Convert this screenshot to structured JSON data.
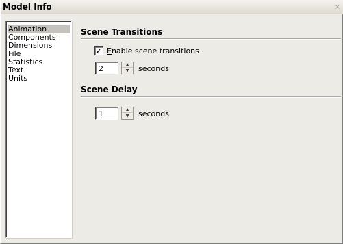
{
  "window": {
    "title": "Model Info",
    "close_glyph": "×"
  },
  "sidebar": {
    "items": [
      {
        "label": "Animation",
        "selected": true
      },
      {
        "label": "Components"
      },
      {
        "label": "Dimensions"
      },
      {
        "label": "File"
      },
      {
        "label": "Statistics"
      },
      {
        "label": "Text"
      },
      {
        "label": "Units"
      }
    ]
  },
  "scene_transitions": {
    "title": "Scene Transitions",
    "checkbox_label_mnemonic": "E",
    "checkbox_label_rest": "nable scene transitions",
    "checked": true,
    "checkmark": "✓",
    "value": "2",
    "unit": "seconds"
  },
  "scene_delay": {
    "title": "Scene Delay",
    "value": "1",
    "unit": "seconds"
  },
  "icons": {
    "spin_up": "▲",
    "spin_down": "▼"
  }
}
